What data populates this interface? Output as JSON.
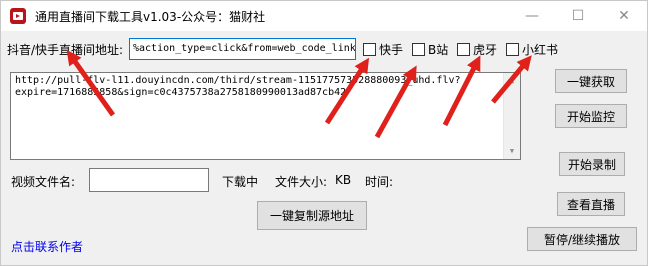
{
  "window": {
    "title": "通用直播间下载工具v1.03-公众号：猫财社",
    "minimize_glyph": "—",
    "maximize_glyph": "☐",
    "close_glyph": "✕"
  },
  "colors": {
    "arrow": "#e0201b",
    "link": "#0000ee",
    "focus": "#0078d7"
  },
  "room": {
    "label": "抖音/快手直播间地址:",
    "value": "%action_type=click&from=web_code_link"
  },
  "platforms": [
    {
      "label": "快手",
      "checked": false
    },
    {
      "label": "B站",
      "checked": false
    },
    {
      "label": "虎牙",
      "checked": false
    },
    {
      "label": "小红书",
      "checked": false
    }
  ],
  "stream": {
    "line1": "http://pull-flv-l11.douyincdn.com/third/stream-115177573528880093_uhd.flv?",
    "line2": "expire=1716885858&sign=c0c4375738a2758180990013ad87cb42"
  },
  "buttons": {
    "fetch": "一键获取",
    "monitor": "开始监控",
    "record": "开始录制",
    "view": "查看直播",
    "copy": "一键复制源地址",
    "pause": "暂停/继续播放"
  },
  "file": {
    "name_label": "视频文件名:",
    "name_value": "",
    "status": "下载中",
    "size_label": "文件大小:",
    "size_unit": "KB",
    "time_label": "时间:"
  },
  "contact_link": "点击联系作者"
}
